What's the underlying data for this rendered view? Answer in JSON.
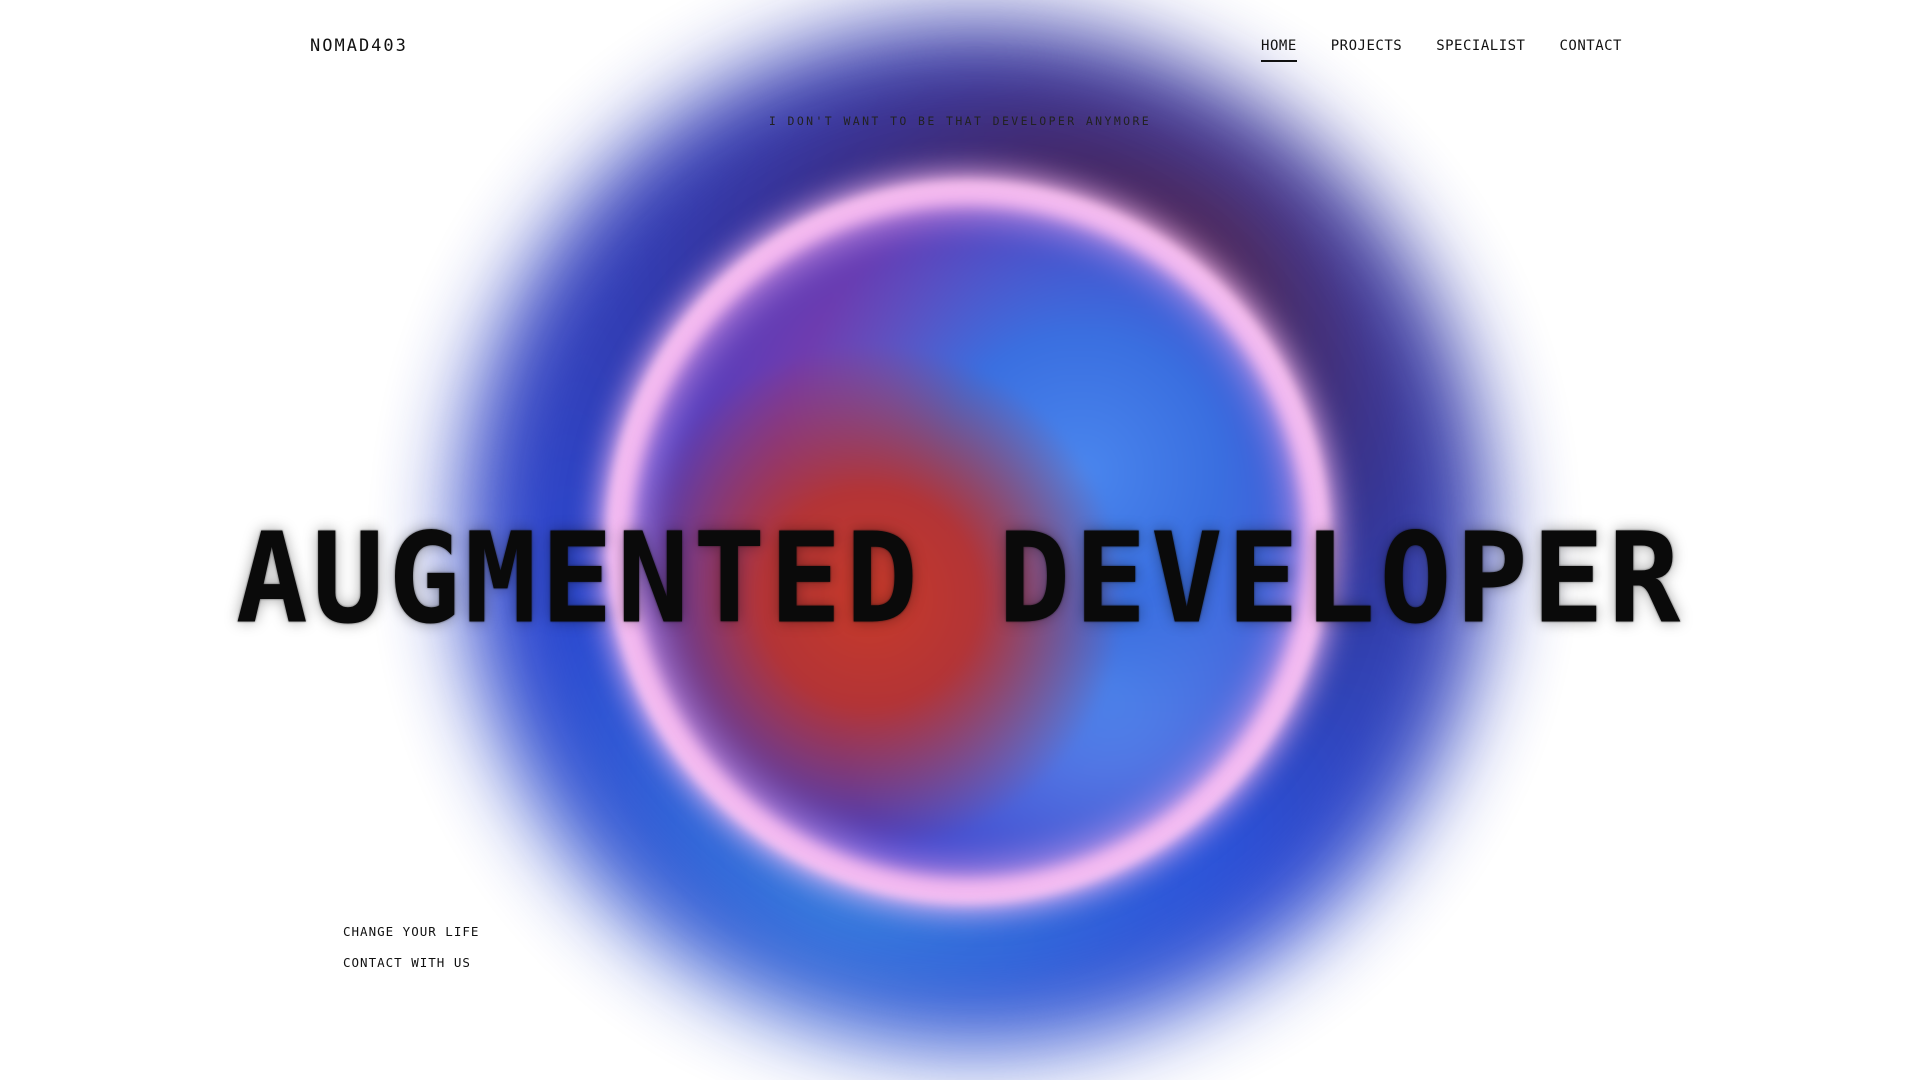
{
  "header": {
    "logo": "NOMAD403",
    "nav": [
      {
        "label": "HOME",
        "active": true
      },
      {
        "label": "PROJECTS",
        "active": false
      },
      {
        "label": "SPECIALIST",
        "active": false
      },
      {
        "label": "CONTACT",
        "active": false
      }
    ]
  },
  "hero": {
    "tagline": "I DON'T WANT TO BE THAT DEVELOPER ANYMORE",
    "headline": "AUGMENTED DEVELOPER"
  },
  "links": [
    {
      "label": "CHANGE YOUR LIFE"
    },
    {
      "label": "CONTACT WITH US"
    }
  ],
  "colors": {
    "background": "#ffffff",
    "text": "#111111",
    "ring": "#ffc2f3",
    "orb_blue": "#1e3fcf",
    "orb_red": "#c73a2a",
    "orb_dark": "#3a1c5e"
  }
}
